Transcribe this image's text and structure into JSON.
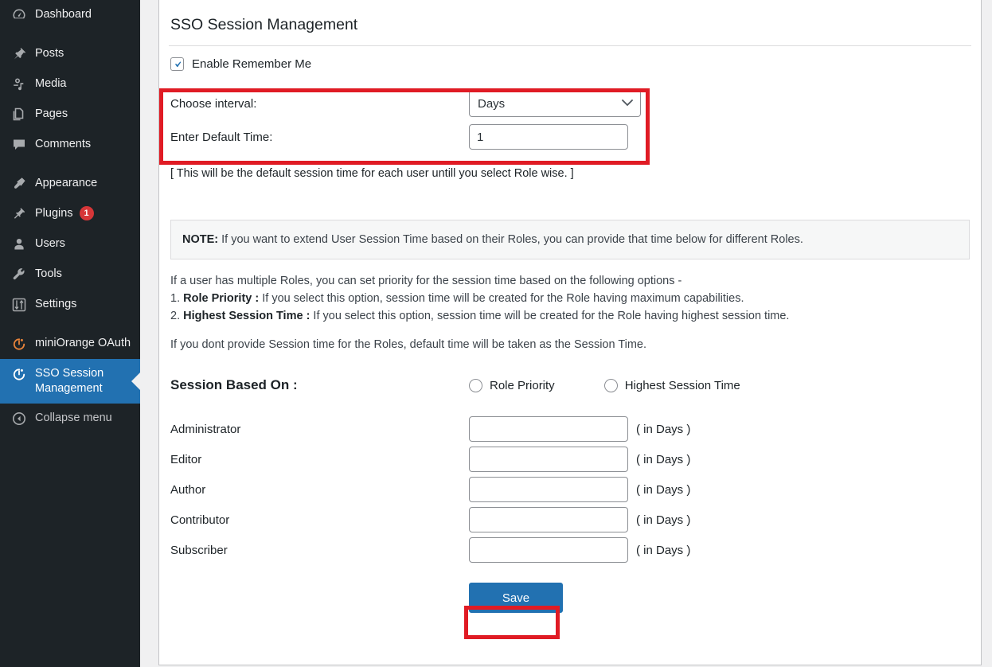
{
  "sidebar": {
    "items": [
      {
        "label": "Dashboard",
        "icon": "dashboard-icon",
        "name": "sidebar-item-dashboard",
        "active": false,
        "badge": null,
        "gap": false
      },
      {
        "label": "Posts",
        "icon": "pin-icon",
        "name": "sidebar-item-posts",
        "active": false,
        "badge": null,
        "gap": true
      },
      {
        "label": "Media",
        "icon": "media-icon",
        "name": "sidebar-item-media",
        "active": false,
        "badge": null,
        "gap": false
      },
      {
        "label": "Pages",
        "icon": "pages-icon",
        "name": "sidebar-item-pages",
        "active": false,
        "badge": null,
        "gap": false
      },
      {
        "label": "Comments",
        "icon": "comment-icon",
        "name": "sidebar-item-comments",
        "active": false,
        "badge": null,
        "gap": false
      },
      {
        "label": "Appearance",
        "icon": "paintbrush-icon",
        "name": "sidebar-item-appearance",
        "active": false,
        "badge": null,
        "gap": true
      },
      {
        "label": "Plugins",
        "icon": "plug-icon",
        "name": "sidebar-item-plugins",
        "active": false,
        "badge": "1",
        "gap": false
      },
      {
        "label": "Users",
        "icon": "user-icon",
        "name": "sidebar-item-users",
        "active": false,
        "badge": null,
        "gap": false
      },
      {
        "label": "Tools",
        "icon": "wrench-icon",
        "name": "sidebar-item-tools",
        "active": false,
        "badge": null,
        "gap": false
      },
      {
        "label": "Settings",
        "icon": "sliders-icon",
        "name": "sidebar-item-settings",
        "active": false,
        "badge": null,
        "gap": false
      },
      {
        "label": "miniOrange OAuth",
        "icon": "miniorange-icon",
        "name": "sidebar-item-miniorange-oauth",
        "active": false,
        "badge": null,
        "gap": true
      },
      {
        "label": "SSO Session Management",
        "icon": "miniorange-icon",
        "name": "sidebar-item-sso-session-management",
        "active": true,
        "badge": null,
        "gap": false
      },
      {
        "label": "Collapse menu",
        "icon": "collapse-arrow-icon",
        "name": "sidebar-item-collapse-menu",
        "active": false,
        "badge": null,
        "gap": false
      }
    ]
  },
  "main": {
    "page_title": "SSO Session Management",
    "remember_me": {
      "label": "Enable Remember Me",
      "checked": true
    },
    "interval": {
      "choose_label": "Choose interval:",
      "select_value": "Days",
      "select_options": [
        "Days"
      ],
      "default_time_label": "Enter Default Time:",
      "default_time_value": "1"
    },
    "hint": "[ This will be the default session time for each user untill you select Role wise. ]",
    "note": {
      "prefix": "NOTE:",
      "text": " If you want to extend User Session Time based on their Roles, you can provide that time below for different Roles."
    },
    "paragraphs": {
      "intro": "If a user has multiple Roles, you can set priority for the session time based on the following options -",
      "item1_num": "1. ",
      "item1_bold": "Role Priority :",
      "item1_rest": " If you select this option, session time will be created for the Role having maximum capabilities.",
      "item2_num": "2. ",
      "item2_bold": "Highest Session Time :",
      "item2_rest": " If you select this option, session time will be created for the Role having highest session time.",
      "closing": "If you dont provide Session time for the Roles, default time will be taken as the Session Time."
    },
    "session_based": {
      "title": "Session Based On :",
      "options": [
        {
          "label": "Role Priority",
          "name": "radio-role-priority",
          "selected": false
        },
        {
          "label": "Highest Session Time",
          "name": "radio-highest-session-time",
          "selected": false
        }
      ]
    },
    "roles": [
      {
        "name": "Administrator",
        "value": "",
        "unit": "( in Days )"
      },
      {
        "name": "Editor",
        "value": "",
        "unit": "( in Days )"
      },
      {
        "name": "Author",
        "value": "",
        "unit": "( in Days )"
      },
      {
        "name": "Contributor",
        "value": "",
        "unit": "( in Days )"
      },
      {
        "name": "Subscriber",
        "value": "",
        "unit": "( in Days )"
      }
    ],
    "save_label": "Save"
  },
  "colors": {
    "sidebar_bg": "#1d2327",
    "accent_blue": "#2271b1",
    "badge_red": "#d63638",
    "annotation_red": "#e01b24",
    "miniorange": "#e8833a"
  }
}
